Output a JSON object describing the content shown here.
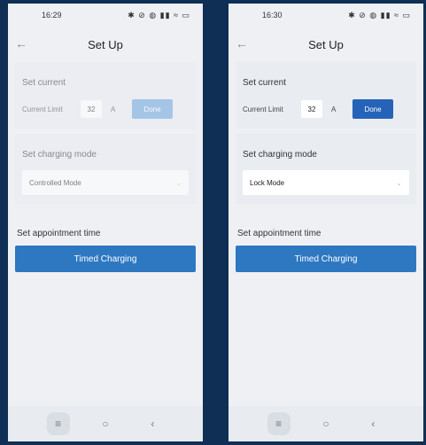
{
  "screens": [
    {
      "status_time": "16:29",
      "status_icons": "✱ ⊘ ◍ ▮▮ ≈ ▭",
      "back_glyph": "←",
      "title": "Set Up",
      "current_section": "Set current",
      "current_label": "Current Limit",
      "current_value": "32",
      "current_unit": "A",
      "done_label": "Done",
      "mode_section": "Set charging mode",
      "mode_value": "Controlled Mode",
      "appointment_section": "Set appointment time",
      "timed_button": "Timed Charging"
    },
    {
      "status_time": "16:30",
      "status_icons": "✱ ⊘ ◍ ▮▮ ≈ ▭",
      "back_glyph": "←",
      "title": "Set Up",
      "current_section": "Set current",
      "current_label": "Current Limit",
      "current_value": "32",
      "current_unit": "A",
      "done_label": "Done",
      "mode_section": "Set charging mode",
      "mode_value": "Lock Mode",
      "appointment_section": "Set appointment time",
      "timed_button": "Timed Charging"
    }
  ],
  "nav": {
    "menu": "≡",
    "home": "○",
    "back": "‹"
  },
  "colors": {
    "background": "#0f2f55",
    "primary_button": "#2e78c2",
    "done_button": "#2563b8"
  }
}
